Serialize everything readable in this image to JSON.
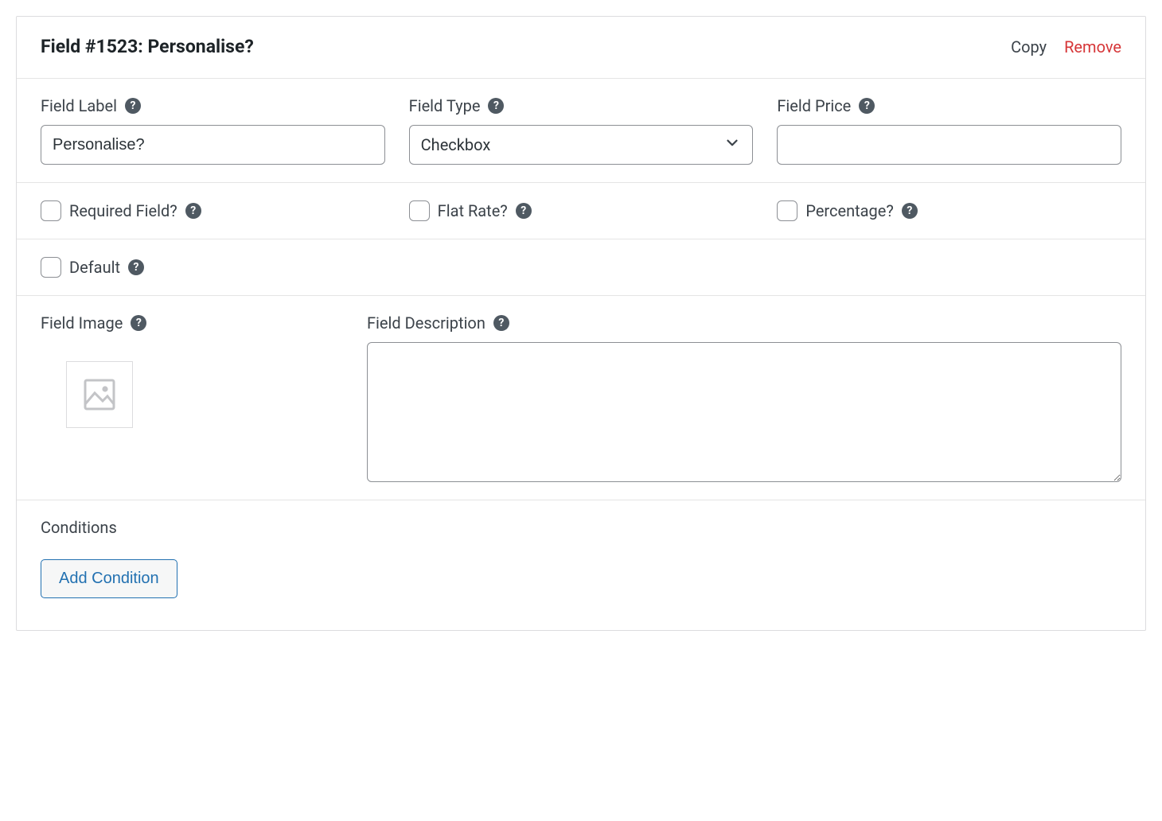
{
  "header": {
    "title": "Field #1523: Personalise?",
    "copy": "Copy",
    "remove": "Remove"
  },
  "fields": {
    "label": {
      "caption": "Field Label",
      "value": "Personalise?"
    },
    "type": {
      "caption": "Field Type",
      "value": "Checkbox"
    },
    "price": {
      "caption": "Field Price",
      "value": ""
    }
  },
  "flags": {
    "required": "Required Field?",
    "flat_rate": "Flat Rate?",
    "percentage": "Percentage?",
    "default": "Default"
  },
  "image": {
    "caption": "Field Image"
  },
  "description": {
    "caption": "Field Description",
    "value": ""
  },
  "conditions": {
    "caption": "Conditions",
    "add_button": "Add Condition"
  }
}
